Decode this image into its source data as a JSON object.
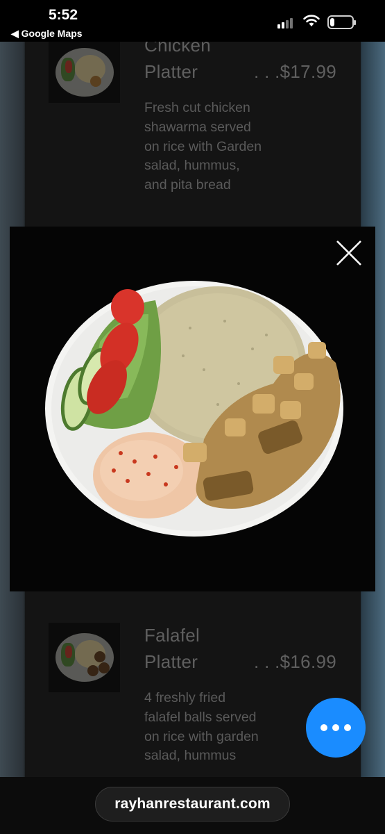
{
  "status_bar": {
    "time": "5:52",
    "back_app": "◀ Google Maps",
    "signal_icon": "cellular-signal-icon",
    "wifi_icon": "wifi-icon",
    "battery_icon": "battery-icon",
    "battery_level": 0.2
  },
  "menu_items": [
    {
      "name_line1": "Chicken",
      "name_line2": "Platter",
      "price": ". . .$17.99",
      "description": "Fresh cut chicken shawarma served on rice with Garden salad, hummus, and pita bread"
    },
    {
      "name_line1": "Falafel",
      "name_line2": "Platter",
      "price": ". . .$16.99",
      "description": "4 freshly fried falafel balls served on rice with garden salad, hummus"
    }
  ],
  "lightbox": {
    "close_icon": "close-icon",
    "image_subject": "chicken shawarma platter photo"
  },
  "chat": {
    "icon": "more-dots-icon",
    "color": "#1a8cff"
  },
  "url_bar": {
    "url": "rayhanrestaurant.com"
  }
}
